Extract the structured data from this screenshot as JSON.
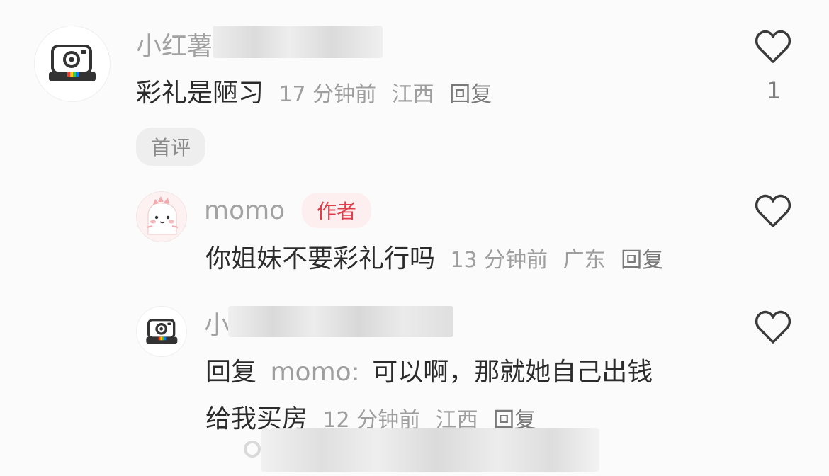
{
  "comments": [
    {
      "username": "小红薯",
      "avatar_icon": "camera-icon",
      "text": "彩礼是陋习",
      "time": "17 分钟前",
      "location": "江西",
      "reply_label": "回复",
      "badge": "首评",
      "likes": "1",
      "like_icon": "heart-icon"
    },
    {
      "username": "momo",
      "avatar_icon": "cartoon-dinosaur-avatar",
      "author_tag": "作者",
      "text": "你姐妹不要彩礼行吗",
      "time": "13 分钟前",
      "location": "广东",
      "reply_label": "回复",
      "like_icon": "heart-icon"
    },
    {
      "username": "小",
      "avatar_icon": "camera-icon",
      "reply_prefix": "回复",
      "reply_to": "momo:",
      "text_line1": "可以啊，那就她自己出钱",
      "text_line2": "给我买房",
      "time": "12 分钟前",
      "location": "江西",
      "reply_label": "回复",
      "like_icon": "heart-icon"
    }
  ],
  "colors": {
    "background": "#fbfbfb",
    "author_tag_text": "#e23c4a",
    "author_tag_bg": "#fdeff0",
    "meta_text": "#9e9e9e"
  }
}
